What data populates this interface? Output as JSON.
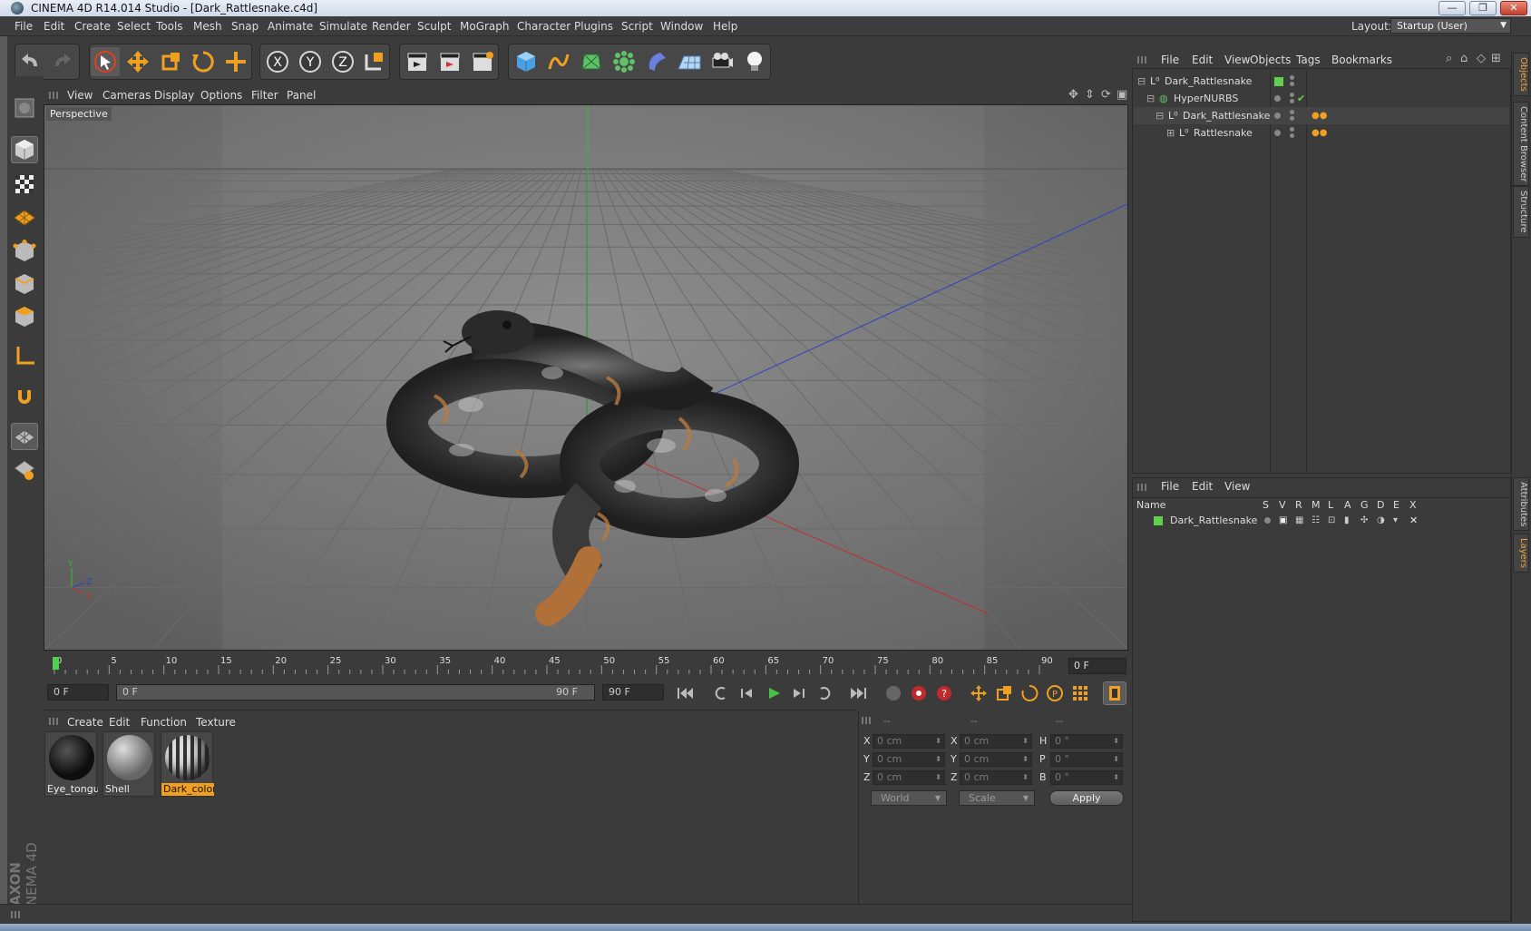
{
  "window": {
    "title": "CINEMA 4D R14.014 Studio - [Dark_Rattlesnake.c4d]",
    "minimize": "—",
    "maximize": "❐",
    "close": "✕"
  },
  "menubar": {
    "items": [
      "File",
      "Edit",
      "Create",
      "Select",
      "Tools",
      "Mesh",
      "Snap",
      "Animate",
      "Simulate",
      "Render",
      "Sculpt",
      "MoGraph",
      "Character",
      "Plugins",
      "Script",
      "Window",
      "Help"
    ],
    "layout_label": "Layout:",
    "layout_value": "Startup (User)"
  },
  "viewport": {
    "menu": [
      "View",
      "Cameras",
      "Display",
      "Options",
      "Filter",
      "Panel"
    ],
    "camera_label": "Perspective",
    "axis": {
      "y": "Y",
      "z": "Z",
      "x": "X"
    }
  },
  "timeline": {
    "ticks": [
      "0",
      "5",
      "10",
      "15",
      "20",
      "25",
      "30",
      "35",
      "40",
      "45",
      "50",
      "55",
      "60",
      "65",
      "70",
      "75",
      "80",
      "85",
      "90"
    ],
    "current_frame": "0 F",
    "start_field": "0 F",
    "range_start": "0 F",
    "range_end": "90 F",
    "end_field": "90 F"
  },
  "materials": {
    "menu": [
      "Create",
      "Edit",
      "Function",
      "Texture"
    ],
    "items": [
      {
        "label": "Eye_tongue",
        "selected": false
      },
      {
        "label": "Shell",
        "selected": false
      },
      {
        "label": "Dark_color",
        "selected": true
      }
    ]
  },
  "coords": {
    "headers": [
      "--",
      "--",
      "--"
    ],
    "rows": [
      {
        "a": "X",
        "av": "0 cm",
        "b": "X",
        "bv": "0 cm",
        "c": "H",
        "cv": "0 °"
      },
      {
        "a": "Y",
        "av": "0 cm",
        "b": "Y",
        "bv": "0 cm",
        "c": "P",
        "cv": "0 °"
      },
      {
        "a": "Z",
        "av": "0 cm",
        "b": "Z",
        "bv": "0 cm",
        "c": "B",
        "cv": "0 °"
      }
    ],
    "space": "World",
    "mode": "Scale",
    "apply": "Apply"
  },
  "objects": {
    "menu": [
      "File",
      "Edit",
      "View",
      "Objects",
      "Tags",
      "Bookmarks"
    ],
    "tree": [
      {
        "name": "Dark_Rattlesnake",
        "depth": 0
      },
      {
        "name": "HyperNURBS",
        "depth": 1
      },
      {
        "name": "Dark_Rattlesnake",
        "depth": 2
      },
      {
        "name": "Rattlesnake",
        "depth": 3
      }
    ]
  },
  "layers": {
    "menu": [
      "File",
      "Edit",
      "View"
    ],
    "columns": [
      "Name",
      "S",
      "V",
      "R",
      "M",
      "L",
      "A",
      "G",
      "D",
      "E",
      "X"
    ],
    "rows": [
      {
        "name": "Dark_Rattlesnake"
      }
    ]
  },
  "side_tabs": [
    "Objects",
    "Content Browser",
    "Structure",
    "Attributes",
    "Layers"
  ],
  "brand": {
    "line1": "MAXON",
    "line2": "CINEMA 4D"
  },
  "colors": {
    "accent": "#f0a020",
    "layer_green": "#5fd04a",
    "axis_x": "#c03030",
    "axis_y": "#30c030",
    "axis_z": "#3040c0"
  }
}
